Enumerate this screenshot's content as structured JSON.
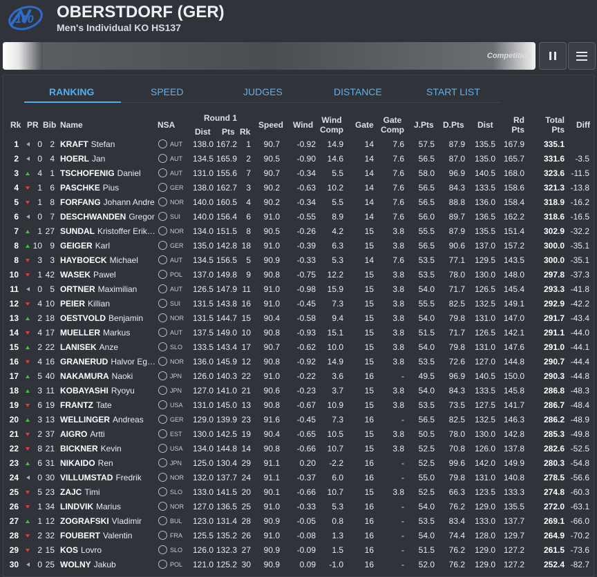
{
  "header": {
    "title": "OBERSTDORF (GER)",
    "subtitle": "Men's Individual KO HS137"
  },
  "progress": {
    "label": "Competition"
  },
  "tabs": [
    "RANKING",
    "SPEED",
    "JUDGES",
    "DISTANCE",
    "START LIST"
  ],
  "columns": {
    "rk": "Rk",
    "pr": "PR",
    "bib": "Bib",
    "name": "Name",
    "nsa": "NSA",
    "round": "Round 1",
    "dist": "Dist",
    "pts": "Pts",
    "rrk": "Rk",
    "speed": "Speed",
    "wind": "Wind",
    "windcomp": [
      "Wind",
      "Comp"
    ],
    "gate": "Gate",
    "gatecomp": [
      "Gate",
      "Comp"
    ],
    "jpts": "J.Pts",
    "dpts": "D.Pts",
    "dist2": "Dist",
    "rdpts": [
      "Rd",
      "Pts"
    ],
    "total": [
      "Total",
      "Pts"
    ],
    "diff": "Diff"
  },
  "rows": [
    {
      "rk": "1",
      "pr": "0",
      "tr": "same",
      "bib": "2",
      "ln": "KRAFT",
      "fn": "Stefan",
      "nsa": "AUT",
      "dist": "138.0",
      "pts": "167.2",
      "rrk": "1",
      "speed": "90.7",
      "wind": "-0.92",
      "wc": "14.9",
      "gate": "14",
      "gc": "7.6",
      "jp": "57.5",
      "dp": "87.9",
      "d2": "135.5",
      "rd": "167.9",
      "tot": "335.1",
      "diff": ""
    },
    {
      "rk": "2",
      "pr": "0",
      "tr": "same",
      "bib": "4",
      "ln": "HOERL",
      "fn": "Jan",
      "nsa": "AUT",
      "dist": "134.5",
      "pts": "165.9",
      "rrk": "2",
      "speed": "90.5",
      "wind": "-0.90",
      "wc": "14.6",
      "gate": "14",
      "gc": "7.6",
      "jp": "56.5",
      "dp": "87.0",
      "d2": "135.0",
      "rd": "165.7",
      "tot": "331.6",
      "diff": "-3.5"
    },
    {
      "rk": "3",
      "pr": "4",
      "tr": "up",
      "bib": "1",
      "ln": "TSCHOFENIG",
      "fn": "Daniel",
      "nsa": "AUT",
      "dist": "131.0",
      "pts": "155.6",
      "rrk": "7",
      "speed": "90.7",
      "wind": "-0.34",
      "wc": "5.5",
      "gate": "14",
      "gc": "7.6",
      "jp": "58.0",
      "dp": "96.9",
      "d2": "140.5",
      "rd": "168.0",
      "tot": "323.6",
      "diff": "-11.5"
    },
    {
      "rk": "4",
      "pr": "1",
      "tr": "down",
      "bib": "6",
      "ln": "PASCHKE",
      "fn": "Pius",
      "nsa": "GER",
      "dist": "138.0",
      "pts": "162.7",
      "rrk": "3",
      "speed": "90.2",
      "wind": "-0.63",
      "wc": "10.2",
      "gate": "14",
      "gc": "7.6",
      "jp": "56.5",
      "dp": "84.3",
      "d2": "133.5",
      "rd": "158.6",
      "tot": "321.3",
      "diff": "-13.8"
    },
    {
      "rk": "5",
      "pr": "1",
      "tr": "down",
      "bib": "8",
      "ln": "FORFANG",
      "fn": "Johann Andre",
      "nsa": "NOR",
      "dist": "140.0",
      "pts": "160.5",
      "rrk": "4",
      "speed": "90.2",
      "wind": "-0.34",
      "wc": "5.5",
      "gate": "14",
      "gc": "7.6",
      "jp": "56.5",
      "dp": "88.8",
      "d2": "136.0",
      "rd": "158.4",
      "tot": "318.9",
      "diff": "-16.2"
    },
    {
      "rk": "6",
      "pr": "0",
      "tr": "same",
      "bib": "7",
      "ln": "DESCHWANDEN",
      "fn": "Gregor",
      "nsa": "SUI",
      "dist": "140.0",
      "pts": "156.4",
      "rrk": "6",
      "speed": "91.0",
      "wind": "-0.55",
      "wc": "8.9",
      "gate": "14",
      "gc": "7.6",
      "jp": "56.0",
      "dp": "89.7",
      "d2": "136.5",
      "rd": "162.2",
      "tot": "318.6",
      "diff": "-16.5"
    },
    {
      "rk": "7",
      "pr": "1",
      "tr": "up",
      "bib": "27",
      "ln": "SUNDAL",
      "fn": "Kristoffer Erik…",
      "nsa": "NOR",
      "dist": "134.0",
      "pts": "151.5",
      "rrk": "8",
      "speed": "90.5",
      "wind": "-0.26",
      "wc": "4.2",
      "gate": "15",
      "gc": "3.8",
      "jp": "55.5",
      "dp": "87.9",
      "d2": "135.5",
      "rd": "151.4",
      "tot": "302.9",
      "diff": "-32.2"
    },
    {
      "rk": "8",
      "pr": "10",
      "tr": "up",
      "bib": "9",
      "ln": "GEIGER",
      "fn": "Karl",
      "nsa": "GER",
      "dist": "135.0",
      "pts": "142.8",
      "rrk": "18",
      "speed": "91.0",
      "wind": "-0.39",
      "wc": "6.3",
      "gate": "15",
      "gc": "3.8",
      "jp": "56.5",
      "dp": "90.6",
      "d2": "137.0",
      "rd": "157.2",
      "tot": "300.0",
      "diff": "-35.1"
    },
    {
      "rk": "8",
      "pr": "3",
      "tr": "down",
      "bib": "3",
      "ln": "HAYBOECK",
      "fn": "Michael",
      "nsa": "AUT",
      "dist": "134.5",
      "pts": "156.5",
      "rrk": "5",
      "speed": "90.9",
      "wind": "-0.33",
      "wc": "5.3",
      "gate": "14",
      "gc": "7.6",
      "jp": "53.5",
      "dp": "77.1",
      "d2": "129.5",
      "rd": "143.5",
      "tot": "300.0",
      "diff": "-35.1"
    },
    {
      "rk": "10",
      "pr": "1",
      "tr": "down",
      "bib": "42",
      "ln": "WASEK",
      "fn": "Pawel",
      "nsa": "POL",
      "dist": "137.0",
      "pts": "149.8",
      "rrk": "9",
      "speed": "90.8",
      "wind": "-0.75",
      "wc": "12.2",
      "gate": "15",
      "gc": "3.8",
      "jp": "53.5",
      "dp": "78.0",
      "d2": "130.0",
      "rd": "148.0",
      "tot": "297.8",
      "diff": "-37.3"
    },
    {
      "rk": "11",
      "pr": "0",
      "tr": "same",
      "bib": "5",
      "ln": "ORTNER",
      "fn": "Maximilian",
      "nsa": "AUT",
      "dist": "126.5",
      "pts": "147.9",
      "rrk": "11",
      "speed": "91.0",
      "wind": "-0.98",
      "wc": "15.9",
      "gate": "15",
      "gc": "3.8",
      "jp": "54.0",
      "dp": "71.7",
      "d2": "126.5",
      "rd": "145.4",
      "tot": "293.3",
      "diff": "-41.8"
    },
    {
      "rk": "12",
      "pr": "4",
      "tr": "down",
      "bib": "10",
      "ln": "PEIER",
      "fn": "Killian",
      "nsa": "SUI",
      "dist": "131.5",
      "pts": "143.8",
      "rrk": "16",
      "speed": "91.0",
      "wind": "-0.45",
      "wc": "7.3",
      "gate": "15",
      "gc": "3.8",
      "jp": "55.5",
      "dp": "82.5",
      "d2": "132.5",
      "rd": "149.1",
      "tot": "292.9",
      "diff": "-42.2"
    },
    {
      "rk": "13",
      "pr": "2",
      "tr": "up",
      "bib": "18",
      "ln": "OESTVOLD",
      "fn": "Benjamin",
      "nsa": "NOR",
      "dist": "131.5",
      "pts": "144.7",
      "rrk": "15",
      "speed": "90.4",
      "wind": "-0.58",
      "wc": "9.4",
      "gate": "15",
      "gc": "3.8",
      "jp": "54.0",
      "dp": "79.8",
      "d2": "131.0",
      "rd": "147.0",
      "tot": "291.7",
      "diff": "-43.4"
    },
    {
      "rk": "14",
      "pr": "4",
      "tr": "down",
      "bib": "17",
      "ln": "MUELLER",
      "fn": "Markus",
      "nsa": "AUT",
      "dist": "137.5",
      "pts": "149.0",
      "rrk": "10",
      "speed": "90.8",
      "wind": "-0.93",
      "wc": "15.1",
      "gate": "15",
      "gc": "3.8",
      "jp": "51.5",
      "dp": "71.7",
      "d2": "126.5",
      "rd": "142.1",
      "tot": "291.1",
      "diff": "-44.0"
    },
    {
      "rk": "15",
      "pr": "2",
      "tr": "up",
      "bib": "22",
      "ln": "LANISEK",
      "fn": "Anze",
      "nsa": "SLO",
      "dist": "133.5",
      "pts": "143.4",
      "rrk": "17",
      "speed": "90.7",
      "wind": "-0.62",
      "wc": "10.0",
      "gate": "15",
      "gc": "3.8",
      "jp": "54.0",
      "dp": "79.8",
      "d2": "131.0",
      "rd": "147.6",
      "tot": "291.0",
      "diff": "-44.1"
    },
    {
      "rk": "16",
      "pr": "4",
      "tr": "down",
      "bib": "16",
      "ln": "GRANERUD",
      "fn": "Halvor Eg…",
      "nsa": "NOR",
      "dist": "136.0",
      "pts": "145.9",
      "rrk": "12",
      "speed": "90.8",
      "wind": "-0.92",
      "wc": "14.9",
      "gate": "15",
      "gc": "3.8",
      "jp": "53.5",
      "dp": "72.6",
      "d2": "127.0",
      "rd": "144.8",
      "tot": "290.7",
      "diff": "-44.4"
    },
    {
      "rk": "17",
      "pr": "5",
      "tr": "up",
      "bib": "40",
      "ln": "NAKAMURA",
      "fn": "Naoki",
      "nsa": "JPN",
      "dist": "126.0",
      "pts": "140.3",
      "rrk": "22",
      "speed": "91.0",
      "wind": "-0.22",
      "wc": "3.6",
      "gate": "16",
      "gc": "-",
      "jp": "49.5",
      "dp": "96.9",
      "d2": "140.5",
      "rd": "150.0",
      "tot": "290.3",
      "diff": "-44.8"
    },
    {
      "rk": "18",
      "pr": "3",
      "tr": "up",
      "bib": "11",
      "ln": "KOBAYASHI",
      "fn": "Ryoyu",
      "nsa": "JPN",
      "dist": "127.0",
      "pts": "141.0",
      "rrk": "21",
      "speed": "90.6",
      "wind": "-0.23",
      "wc": "3.7",
      "gate": "15",
      "gc": "3.8",
      "jp": "54.0",
      "dp": "84.3",
      "d2": "133.5",
      "rd": "145.8",
      "tot": "286.8",
      "diff": "-48.3"
    },
    {
      "rk": "19",
      "pr": "6",
      "tr": "down",
      "bib": "19",
      "ln": "FRANTZ",
      "fn": "Tate",
      "nsa": "USA",
      "dist": "131.0",
      "pts": "145.0",
      "rrk": "13",
      "speed": "90.8",
      "wind": "-0.67",
      "wc": "10.9",
      "gate": "15",
      "gc": "3.8",
      "jp": "53.5",
      "dp": "73.5",
      "d2": "127.5",
      "rd": "141.7",
      "tot": "286.7",
      "diff": "-48.4"
    },
    {
      "rk": "20",
      "pr": "3",
      "tr": "up",
      "bib": "13",
      "ln": "WELLINGER",
      "fn": "Andreas",
      "nsa": "GER",
      "dist": "129.0",
      "pts": "139.9",
      "rrk": "23",
      "speed": "91.6",
      "wind": "-0.45",
      "wc": "7.3",
      "gate": "16",
      "gc": "-",
      "jp": "56.5",
      "dp": "82.5",
      "d2": "132.5",
      "rd": "146.3",
      "tot": "286.2",
      "diff": "-48.9"
    },
    {
      "rk": "21",
      "pr": "2",
      "tr": "down",
      "bib": "37",
      "ln": "AIGRO",
      "fn": "Artti",
      "nsa": "EST",
      "dist": "130.0",
      "pts": "142.5",
      "rrk": "19",
      "speed": "90.4",
      "wind": "-0.65",
      "wc": "10.5",
      "gate": "15",
      "gc": "3.8",
      "jp": "50.5",
      "dp": "78.0",
      "d2": "130.0",
      "rd": "142.8",
      "tot": "285.3",
      "diff": "-49.8"
    },
    {
      "rk": "22",
      "pr": "8",
      "tr": "down",
      "bib": "21",
      "ln": "BICKNER",
      "fn": "Kevin",
      "nsa": "USA",
      "dist": "134.0",
      "pts": "144.8",
      "rrk": "14",
      "speed": "90.8",
      "wind": "-0.66",
      "wc": "10.7",
      "gate": "15",
      "gc": "3.8",
      "jp": "52.5",
      "dp": "70.8",
      "d2": "126.0",
      "rd": "137.8",
      "tot": "282.6",
      "diff": "-52.5"
    },
    {
      "rk": "23",
      "pr": "6",
      "tr": "up",
      "bib": "31",
      "ln": "NIKAIDO",
      "fn": "Ren",
      "nsa": "JPN",
      "dist": "125.0",
      "pts": "130.4",
      "rrk": "29",
      "speed": "91.1",
      "wind": "0.20",
      "wc": "-2.2",
      "gate": "16",
      "gc": "-",
      "jp": "52.5",
      "dp": "99.6",
      "d2": "142.0",
      "rd": "149.9",
      "tot": "280.3",
      "diff": "-54.8"
    },
    {
      "rk": "24",
      "pr": "0",
      "tr": "same",
      "bib": "30",
      "ln": "VILLUMSTAD",
      "fn": "Fredrik",
      "nsa": "NOR",
      "dist": "132.0",
      "pts": "137.7",
      "rrk": "24",
      "speed": "91.1",
      "wind": "-0.37",
      "wc": "6.0",
      "gate": "16",
      "gc": "-",
      "jp": "55.0",
      "dp": "79.8",
      "d2": "131.0",
      "rd": "140.8",
      "tot": "278.5",
      "diff": "-56.6"
    },
    {
      "rk": "25",
      "pr": "5",
      "tr": "down",
      "bib": "23",
      "ln": "ZAJC",
      "fn": "Timi",
      "nsa": "SLO",
      "dist": "133.0",
      "pts": "141.5",
      "rrk": "20",
      "speed": "90.1",
      "wind": "-0.66",
      "wc": "10.7",
      "gate": "15",
      "gc": "3.8",
      "jp": "52.5",
      "dp": "66.3",
      "d2": "123.5",
      "rd": "133.3",
      "tot": "274.8",
      "diff": "-60.3"
    },
    {
      "rk": "26",
      "pr": "1",
      "tr": "down",
      "bib": "34",
      "ln": "LINDVIK",
      "fn": "Marius",
      "nsa": "NOR",
      "dist": "127.0",
      "pts": "136.5",
      "rrk": "25",
      "speed": "91.0",
      "wind": "-0.33",
      "wc": "5.3",
      "gate": "16",
      "gc": "-",
      "jp": "54.0",
      "dp": "76.2",
      "d2": "129.0",
      "rd": "135.5",
      "tot": "272.0",
      "diff": "-63.1"
    },
    {
      "rk": "27",
      "pr": "1",
      "tr": "up",
      "bib": "12",
      "ln": "ZOGRAFSKI",
      "fn": "Vladimir",
      "nsa": "BUL",
      "dist": "123.0",
      "pts": "131.4",
      "rrk": "28",
      "speed": "90.9",
      "wind": "-0.05",
      "wc": "0.8",
      "gate": "16",
      "gc": "-",
      "jp": "53.5",
      "dp": "83.4",
      "d2": "133.0",
      "rd": "137.7",
      "tot": "269.1",
      "diff": "-66.0"
    },
    {
      "rk": "28",
      "pr": "2",
      "tr": "down",
      "bib": "32",
      "ln": "FOUBERT",
      "fn": "Valentin",
      "nsa": "FRA",
      "dist": "125.5",
      "pts": "135.2",
      "rrk": "26",
      "speed": "91.0",
      "wind": "-0.08",
      "wc": "1.3",
      "gate": "16",
      "gc": "-",
      "jp": "54.0",
      "dp": "74.4",
      "d2": "128.0",
      "rd": "129.7",
      "tot": "264.9",
      "diff": "-70.2"
    },
    {
      "rk": "29",
      "pr": "2",
      "tr": "down",
      "bib": "15",
      "ln": "KOS",
      "fn": "Lovro",
      "nsa": "SLO",
      "dist": "126.0",
      "pts": "132.3",
      "rrk": "27",
      "speed": "90.9",
      "wind": "-0.09",
      "wc": "1.5",
      "gate": "16",
      "gc": "-",
      "jp": "51.5",
      "dp": "76.2",
      "d2": "129.0",
      "rd": "127.2",
      "tot": "261.5",
      "diff": "-73.6"
    },
    {
      "rk": "30",
      "pr": "0",
      "tr": "same",
      "bib": "25",
      "ln": "WOLNY",
      "fn": "Jakub",
      "nsa": "POL",
      "dist": "121.0",
      "pts": "125.2",
      "rrk": "30",
      "speed": "90.9",
      "wind": "0.09",
      "wc": "-1.0",
      "gate": "16",
      "gc": "-",
      "jp": "52.0",
      "dp": "76.2",
      "d2": "129.0",
      "rd": "127.2",
      "tot": "252.4",
      "diff": "-82.7"
    }
  ]
}
